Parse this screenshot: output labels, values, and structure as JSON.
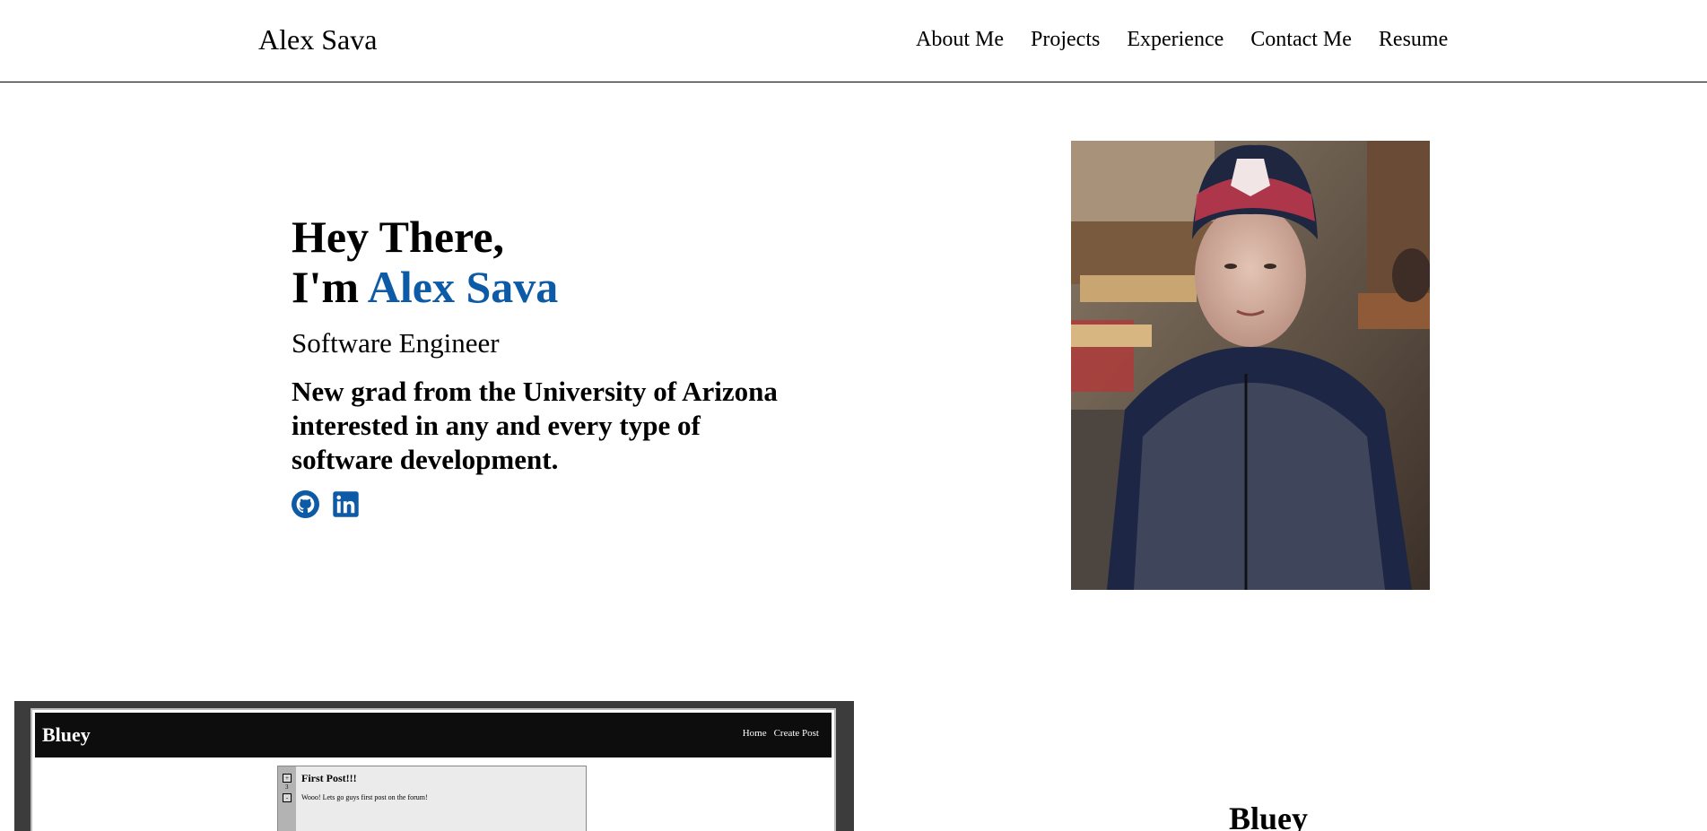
{
  "header": {
    "logo": "Alex Sava",
    "nav": [
      "About Me",
      "Projects",
      "Experience",
      "Contact Me",
      "Resume"
    ]
  },
  "hero": {
    "greeting_line1": "Hey There,",
    "greeting_prefix": "I'm ",
    "name": "Alex Sava",
    "role": "Software Engineer",
    "description": "New grad from the University of Arizona interested in any and every type of software development.",
    "socials": [
      {
        "icon": "github-icon"
      },
      {
        "icon": "linkedin-icon"
      }
    ],
    "accent_color": "#0d5aa7"
  },
  "portrait": {
    "icon": "profile-photo"
  },
  "project": {
    "screenshot": {
      "brand": "Bluey",
      "nav": [
        "Home",
        "Create Post"
      ],
      "post": {
        "title": "First Post!!!",
        "body": "Wooo! Lets go guys first post on the forum!",
        "votes": "3"
      }
    },
    "title": "Bluey"
  }
}
